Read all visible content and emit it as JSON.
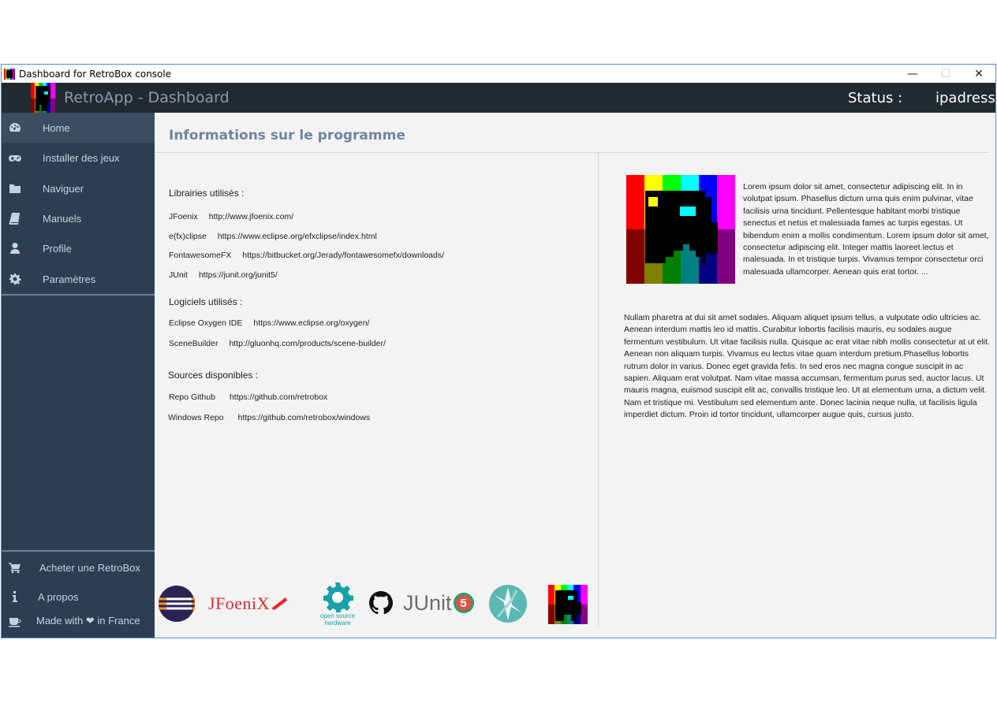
{
  "window": {
    "title": "Dashboard for RetroBox console",
    "controls": {
      "minimize": "—",
      "maximize": "☐",
      "close": "✕"
    }
  },
  "appbar": {
    "title": "RetroApp - Dashboard",
    "status_label": "Status :",
    "ip_label": "ipadresse"
  },
  "sidebar": {
    "items": [
      {
        "label": "Home",
        "icon": "dashboard-icon"
      },
      {
        "label": "Installer des jeux",
        "icon": "gamepad-icon"
      },
      {
        "label": "Naviguer",
        "icon": "folder-icon"
      },
      {
        "label": "Manuels",
        "icon": "book-icon"
      },
      {
        "label": "Profile",
        "icon": "user-icon"
      },
      {
        "label": "Paramètres",
        "icon": "gear-icon"
      }
    ],
    "active": "Home",
    "bottom": [
      {
        "label": "Acheter une RetroBox",
        "icon": "cart-icon"
      },
      {
        "label": "A propos",
        "icon": "info-icon"
      },
      {
        "label": "Made with ❤ in France",
        "icon": "coffee-icon"
      }
    ]
  },
  "main": {
    "title": "Informations sur le programme",
    "libraries_heading": "Librairies utilisés :",
    "libraries": [
      {
        "name": "JFoenix",
        "url": "http://www.jfoenix.com/"
      },
      {
        "name": "e(fx)clipse",
        "url": "https://www.eclipse.org/efxclipse/index.html"
      },
      {
        "name": "FontawesomeFX",
        "url": "https://bitbucket.org/Jerady/fontawesomefx/downloads/"
      },
      {
        "name": "JUnit",
        "url": "https://junit.org/junit5/"
      }
    ],
    "software_heading": "Logiciels utilisés :",
    "software": [
      {
        "name": "Eclipse Oxygen IDE",
        "url": "https://www.eclipse.org/oxygen/"
      },
      {
        "name": "SceneBuilder",
        "url": "http://gluonhq.com/products/scene-builder/"
      }
    ],
    "sources_heading": "Sources disponibles :",
    "sources": [
      {
        "name": "Repo Github",
        "url": "https://github.com/retrobox"
      },
      {
        "name": "Windows Repo",
        "url": "https://github.com/retrobox/windows"
      }
    ],
    "para1": "Lorem ipsum dolor sit amet, consectetur adipiscing elit. In in volutpat ipsum. Phasellus dictum urna quis enim pulvinar, vitae facilisis urna tincidunt. Pellentesque habitant morbi tristique senectus et netus et malesuada fames ac turpis egestas. Ut bibendum enim a mollis condimentum. Lorem ipsum dolor sit amet, consectetur adipiscing elit. Integer mattis laoreet lectus et malesuada. In et tristique turpis. Vivamus tempor consectetur orci malesuada ullamcorper. Aenean quis erat tortor. ...",
    "para2": "Nullam pharetra at dui sit amet sodales. Aliquam aliquet ipsum tellus, a vulputate odio ultricies ac. Aenean interdum mattis leo id mattis. Curabitur lobortis facilisis mauris, eu sodales augue fermentum vestibulum. Ut vitae facilisis nulla. Quisque ac erat vitae nibh mollis consectetur at ut elit. Aenean non aliquam turpis. Vivamus eu lectus vitae quam interdum pretium.Phasellus lobortis rutrum dolor in varius. Donec eget gravida felis. In sed eros nec magna congue suscipit in ac sapien. Aliquam erat volutpat. Nam vitae massa accumsan, fermentum purus sed, auctor lacus. Ut mauris magna, euismod suscipit elit ac, convallis tristique leo. Ut at elementum urna, a dictum velit. Nam et tristique mi. Vestibulum sed elementum ante. Donec lacinia neque nulla, ut facilisis ligula imperdiet dictum. Proin id tortor tincidunt, ullamcorper augue quis, cursus justo."
  },
  "logos": {
    "jfoenix": "JFoeniX",
    "osh_line1": "open source",
    "osh_line2": "hardware",
    "junit_text": "JUnit",
    "junit_num": "5"
  },
  "colors": {
    "appbar": "#212a31",
    "sidebar": "#2c3e52",
    "accent_title": "#6f84a0"
  }
}
